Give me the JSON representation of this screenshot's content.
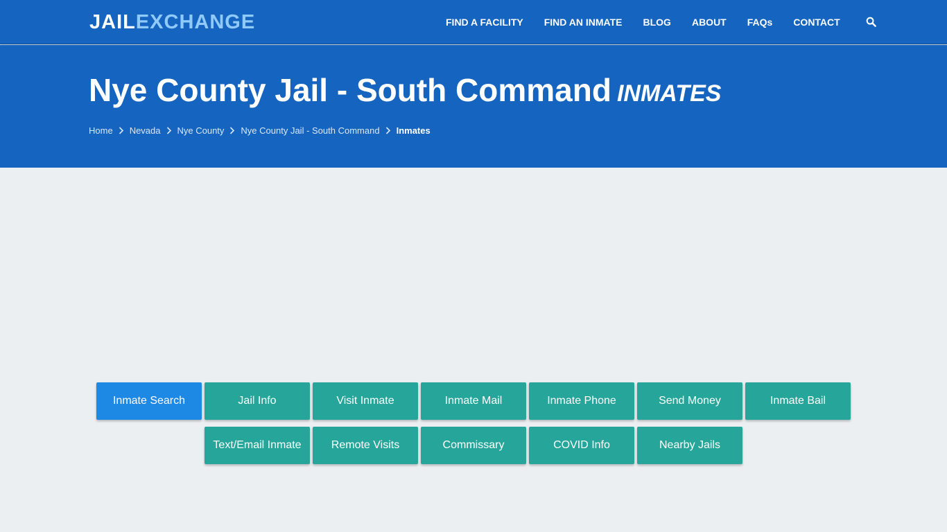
{
  "brand": {
    "part1": "JAIL",
    "part2": "EXCHANGE"
  },
  "nav": {
    "items": [
      {
        "label": "FIND A FACILITY"
      },
      {
        "label": "FIND AN INMATE"
      },
      {
        "label": "BLOG"
      },
      {
        "label": "ABOUT"
      },
      {
        "label": "FAQs"
      },
      {
        "label": "CONTACT"
      }
    ],
    "search_icon": "search-icon"
  },
  "hero": {
    "title": "Nye County Jail - South Command",
    "subtitle": "INMATES"
  },
  "breadcrumb": [
    {
      "label": "Home"
    },
    {
      "label": "Nevada"
    },
    {
      "label": "Nye County"
    },
    {
      "label": "Nye County Jail - South Command"
    },
    {
      "label": "Inmates"
    }
  ],
  "buttons": {
    "row1": [
      {
        "label": "Inmate Search",
        "active": true
      },
      {
        "label": "Jail Info"
      },
      {
        "label": "Visit Inmate"
      },
      {
        "label": "Inmate Mail"
      },
      {
        "label": "Inmate Phone"
      },
      {
        "label": "Send Money"
      },
      {
        "label": "Inmate Bail"
      }
    ],
    "row2": [
      {
        "label": "Text/Email Inmate"
      },
      {
        "label": "Remote Visits"
      },
      {
        "label": "Commissary"
      },
      {
        "label": "COVID Info"
      },
      {
        "label": "Nearby Jails"
      }
    ]
  },
  "colors": {
    "primary": "#1565c0",
    "accent_light": "#90caf9",
    "button": "#26a69a",
    "button_active": "#1e88e5",
    "background": "#eceff2"
  }
}
